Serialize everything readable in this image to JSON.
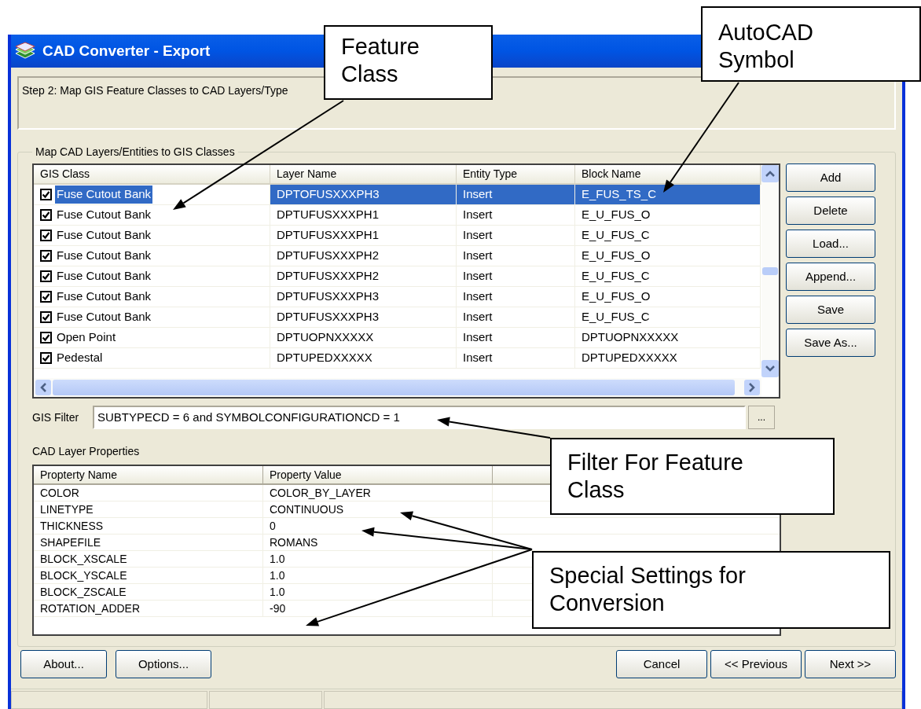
{
  "window": {
    "title": "CAD Converter - Export"
  },
  "step_text": "Step 2: Map GIS Feature Classes to CAD Layers/Type",
  "group_title": "Map CAD Layers/Entities to GIS Classes",
  "mapping_table": {
    "columns": [
      "GIS Class",
      "Layer Name",
      "Entity Type",
      "Block Name"
    ],
    "rows": [
      {
        "checked": true,
        "selected": true,
        "gis_class": "Fuse Cutout Bank",
        "layer_name": "DPTOFUSXXXPH3",
        "entity_type": "Insert",
        "block_name": "E_FUS_TS_C"
      },
      {
        "checked": true,
        "selected": false,
        "gis_class": "Fuse Cutout Bank",
        "layer_name": "DPTUFUSXXXPH1",
        "entity_type": "Insert",
        "block_name": "E_U_FUS_O"
      },
      {
        "checked": true,
        "selected": false,
        "gis_class": "Fuse Cutout Bank",
        "layer_name": "DPTUFUSXXXPH1",
        "entity_type": "Insert",
        "block_name": "E_U_FUS_C"
      },
      {
        "checked": true,
        "selected": false,
        "gis_class": "Fuse Cutout Bank",
        "layer_name": "DPTUFUSXXXPH2",
        "entity_type": "Insert",
        "block_name": "E_U_FUS_O"
      },
      {
        "checked": true,
        "selected": false,
        "gis_class": "Fuse Cutout Bank",
        "layer_name": "DPTUFUSXXXPH2",
        "entity_type": "Insert",
        "block_name": "E_U_FUS_C"
      },
      {
        "checked": true,
        "selected": false,
        "gis_class": "Fuse Cutout Bank",
        "layer_name": "DPTUFUSXXXPH3",
        "entity_type": "Insert",
        "block_name": "E_U_FUS_O"
      },
      {
        "checked": true,
        "selected": false,
        "gis_class": "Fuse Cutout Bank",
        "layer_name": "DPTUFUSXXXPH3",
        "entity_type": "Insert",
        "block_name": "E_U_FUS_C"
      },
      {
        "checked": true,
        "selected": false,
        "gis_class": "Open Point",
        "layer_name": "DPTUOPNXXXXX",
        "entity_type": "Insert",
        "block_name": "DPTUOPNXXXXX"
      },
      {
        "checked": true,
        "selected": false,
        "gis_class": "Pedestal",
        "layer_name": "DPTUPEDXXXXX",
        "entity_type": "Insert",
        "block_name": "DPTUPEDXXXXX"
      }
    ]
  },
  "side_buttons": [
    "Add",
    "Delete",
    "Load...",
    "Append...",
    "Save",
    "Save As..."
  ],
  "gis_filter": {
    "label": "GIS Filter",
    "value": "SUBTYPECD = 6 and SYMBOLCONFIGURATIONCD = 1",
    "browse_button": "..."
  },
  "properties": {
    "title": "CAD Layer Properties",
    "columns": [
      "Propterty Name",
      "Property Value"
    ],
    "rows": [
      {
        "name": "COLOR",
        "value": "COLOR_BY_LAYER"
      },
      {
        "name": "LINETYPE",
        "value": "CONTINUOUS"
      },
      {
        "name": "THICKNESS",
        "value": "0"
      },
      {
        "name": "SHAPEFILE",
        "value": "ROMANS"
      },
      {
        "name": "BLOCK_XSCALE",
        "value": "1.0"
      },
      {
        "name": "BLOCK_YSCALE",
        "value": "1.0"
      },
      {
        "name": "BLOCK_ZSCALE",
        "value": "1.0"
      },
      {
        "name": "ROTATION_ADDER",
        "value": "-90"
      }
    ]
  },
  "footer_buttons_left": [
    "About...",
    "Options..."
  ],
  "footer_buttons_right": [
    "Cancel",
    "<< Previous",
    "Next >>"
  ],
  "callouts": [
    {
      "text": "Feature Class"
    },
    {
      "text": "AutoCAD Symbol"
    },
    {
      "text": "Filter For Feature Class"
    },
    {
      "text": "Special Settings for Conversion"
    }
  ]
}
